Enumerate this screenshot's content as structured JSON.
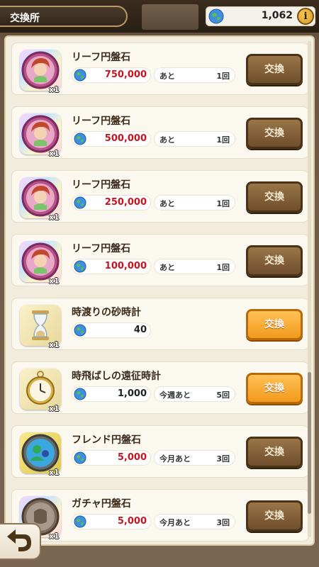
{
  "header": {
    "title": "交換所",
    "currency_value": "1,062",
    "info_label": "i"
  },
  "colors": {
    "cost_red": "#c8141e",
    "cost_black": "#222222",
    "button_brown": "#7a5a33",
    "button_orange": "#f5a023"
  },
  "items": [
    {
      "name": "リーフ円盤石",
      "qty": "x1",
      "cost": "750,000",
      "cost_color": "red",
      "remain_prefix": "あと",
      "remain_count": "1回",
      "button": "交換",
      "button_style": "brown",
      "icon": "leaf-character-medal-icon"
    },
    {
      "name": "リーフ円盤石",
      "qty": "x1",
      "cost": "500,000",
      "cost_color": "red",
      "remain_prefix": "あと",
      "remain_count": "1回",
      "button": "交換",
      "button_style": "brown",
      "icon": "leaf-character-medal-icon"
    },
    {
      "name": "リーフ円盤石",
      "qty": "x1",
      "cost": "250,000",
      "cost_color": "red",
      "remain_prefix": "あと",
      "remain_count": "1回",
      "button": "交換",
      "button_style": "brown",
      "icon": "leaf-character-medal-icon"
    },
    {
      "name": "リーフ円盤石",
      "qty": "x1",
      "cost": "100,000",
      "cost_color": "red",
      "remain_prefix": "あと",
      "remain_count": "1回",
      "button": "交換",
      "button_style": "brown",
      "icon": "leaf-character-medal-icon"
    },
    {
      "name": "時渡りの砂時計",
      "qty": "x1",
      "cost": "40",
      "cost_color": "black",
      "remain_prefix": "",
      "remain_count": "",
      "button": "交換",
      "button_style": "orange",
      "icon": "hourglass-icon"
    },
    {
      "name": "時飛ばしの遠征時計",
      "qty": "x1",
      "cost": "1,000",
      "cost_color": "black",
      "remain_prefix": "今週あと",
      "remain_count": "5回",
      "button": "交換",
      "button_style": "orange",
      "icon": "pocket-watch-icon"
    },
    {
      "name": "フレンド円盤石",
      "qty": "x1",
      "cost": "5,000",
      "cost_color": "red",
      "remain_prefix": "今月あと",
      "remain_count": "3回",
      "button": "交換",
      "button_style": "brown",
      "icon": "friend-medal-icon"
    },
    {
      "name": "ガチャ円盤石",
      "qty": "x1",
      "cost": "5,000",
      "cost_color": "red",
      "remain_prefix": "今月あと",
      "remain_count": "3回",
      "button": "交換",
      "button_style": "brown",
      "icon": "gacha-medal-icon"
    }
  ]
}
